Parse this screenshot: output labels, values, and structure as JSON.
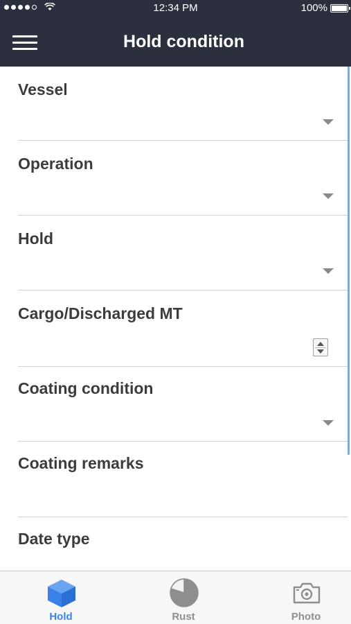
{
  "status_bar": {
    "time": "12:34 PM",
    "battery": "100%"
  },
  "header": {
    "title": "Hold condition",
    "menu_icon": "hamburger-menu-icon"
  },
  "form": {
    "fields": [
      {
        "label": "Vessel",
        "type": "dropdown",
        "value": ""
      },
      {
        "label": "Operation",
        "type": "dropdown",
        "value": ""
      },
      {
        "label": "Hold",
        "type": "dropdown",
        "value": ""
      },
      {
        "label": "Cargo/Discharged MT",
        "type": "number",
        "value": ""
      },
      {
        "label": "Coating condition",
        "type": "dropdown",
        "value": ""
      },
      {
        "label": "Coating remarks",
        "type": "text",
        "value": ""
      },
      {
        "label": "Date type",
        "type": "dropdown",
        "value": ""
      }
    ]
  },
  "tab_bar": {
    "tabs": [
      {
        "label": "Hold",
        "icon": "cube-icon",
        "active": true
      },
      {
        "label": "Rust",
        "icon": "pie-chart-icon",
        "active": false
      },
      {
        "label": "Photo",
        "icon": "camera-icon",
        "active": false
      }
    ]
  },
  "colors": {
    "header_bg": "#2b2f3e",
    "active_tab": "#3b82e8",
    "inactive_tab": "#8e8e8e"
  }
}
